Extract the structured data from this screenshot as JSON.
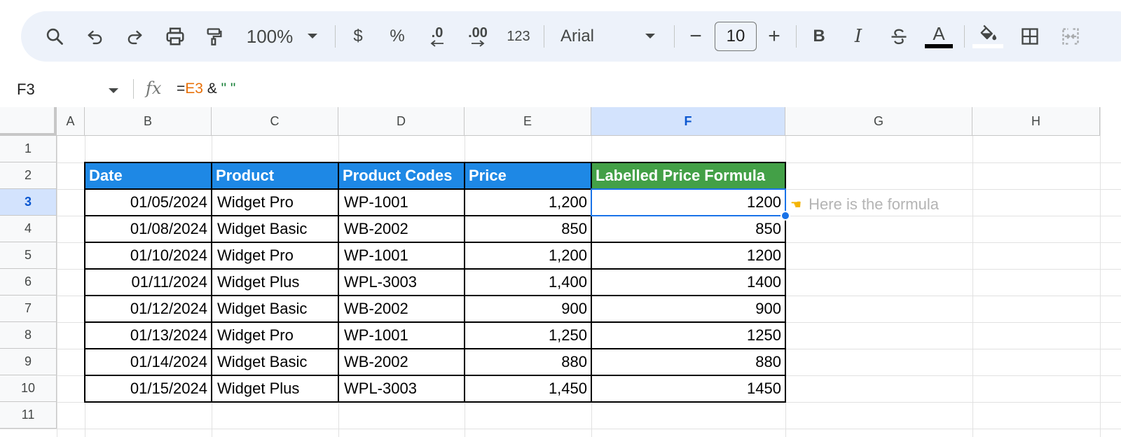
{
  "toolbar": {
    "zoom": "100%",
    "currency_label": "$",
    "percent_label": "%",
    "decrease_decimal_label": ".0",
    "increase_decimal_label": ".00",
    "number_format_label": "123",
    "font_name": "Arial",
    "font_size": "10",
    "font_size_minus": "−",
    "font_size_plus": "+",
    "bold_label": "B",
    "italic_label": "I",
    "text_color_label": "A",
    "text_color": "#000000",
    "fill_color": "#ffffff"
  },
  "formula_bar": {
    "name_box": "F3",
    "fx_label": "fx",
    "formula_eq": "=",
    "formula_ref": "E3",
    "formula_op": " & ",
    "formula_str": "\" \""
  },
  "columns": [
    "A",
    "B",
    "C",
    "D",
    "E",
    "F",
    "G",
    "H"
  ],
  "selected_column": "F",
  "rows": [
    "1",
    "2",
    "3",
    "4",
    "5",
    "6",
    "7",
    "8",
    "9",
    "10",
    "11"
  ],
  "selected_row": "3",
  "table": {
    "headers": [
      "Date",
      "Product",
      "Product Codes",
      "Price",
      "Labelled Price Formula"
    ],
    "header_color": "#1e88e5",
    "formula_header_color": "#43a047",
    "rows": [
      [
        "01/05/2024",
        "Widget Pro",
        "WP-1001",
        "1,200",
        "1200"
      ],
      [
        "01/08/2024",
        "Widget Basic",
        "WB-2002",
        "850",
        "850"
      ],
      [
        "01/10/2024",
        "Widget Pro",
        "WP-1001",
        "1,200",
        "1200"
      ],
      [
        "01/11/2024",
        "Widget Plus",
        "WPL-3003",
        "1,400",
        "1400"
      ],
      [
        "01/12/2024",
        "Widget Basic",
        "WB-2002",
        "900",
        "900"
      ],
      [
        "01/13/2024",
        "Widget Pro",
        "WP-1001",
        "1,250",
        "1250"
      ],
      [
        "01/14/2024",
        "Widget Basic",
        "WB-2002",
        "880",
        "880"
      ],
      [
        "01/15/2024",
        "Widget Plus",
        "WPL-3003",
        "1,450",
        "1450"
      ]
    ]
  },
  "annotation": {
    "icon": "pointing-hand-icon",
    "text": "Here is the formula"
  }
}
